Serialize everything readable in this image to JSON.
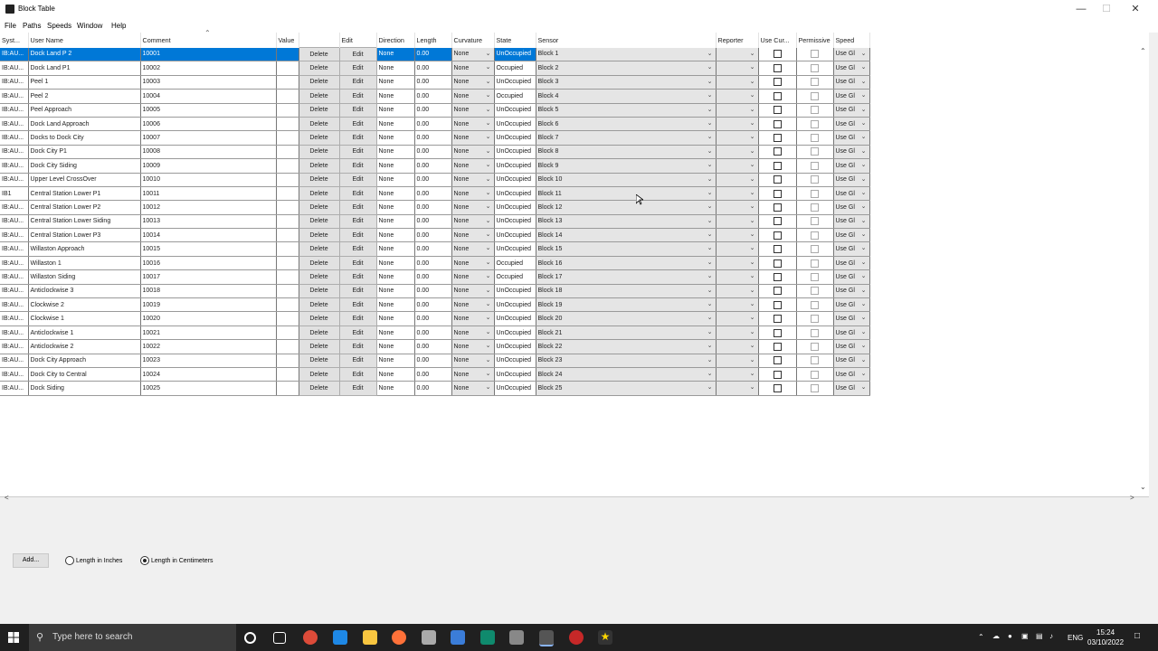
{
  "window": {
    "title": "Block Table"
  },
  "menu": [
    "File",
    "Paths",
    "Speeds",
    "Window",
    "Help"
  ],
  "columns": [
    "Syst...",
    "User Name",
    "Comment",
    "Value",
    "",
    "Edit",
    "Direction",
    "Length",
    "Curvature",
    "State",
    "Sensor",
    "Reporter",
    "Use Cur...",
    "Permissive",
    "Speed"
  ],
  "row_defaults": {
    "system_prefix": "IB:AU...",
    "delete_label": "Delete",
    "edit_label": "Edit",
    "direction": "None",
    "length": "0.00",
    "curvature": "None",
    "speed": "Use Gl"
  },
  "rows": [
    {
      "sys": "IB:AU...",
      "name": "Dock Land P 2",
      "comment": "10001",
      "state": "UnOccupied",
      "sensor": "Block 1",
      "selected": true
    },
    {
      "sys": "IB:AU...",
      "name": "Dock Land P1",
      "comment": "10002",
      "state": "Occupied",
      "sensor": "Block 2"
    },
    {
      "sys": "IB:AU...",
      "name": "Peel 1",
      "comment": "10003",
      "state": "UnOccupied",
      "sensor": "Block 3"
    },
    {
      "sys": "IB:AU...",
      "name": "Peel 2",
      "comment": "10004",
      "state": "Occupied",
      "sensor": "Block 4"
    },
    {
      "sys": "IB:AU...",
      "name": "Peel Approach",
      "comment": "10005",
      "state": "UnOccupied",
      "sensor": "Block 5"
    },
    {
      "sys": "IB:AU...",
      "name": "Dock Land Approach",
      "comment": "10006",
      "state": "UnOccupied",
      "sensor": "Block 6"
    },
    {
      "sys": "IB:AU...",
      "name": "Docks to Dock City",
      "comment": "10007",
      "state": "UnOccupied",
      "sensor": "Block 7"
    },
    {
      "sys": "IB:AU...",
      "name": "Dock City P1",
      "comment": "10008",
      "state": "UnOccupied",
      "sensor": "Block 8"
    },
    {
      "sys": "IB:AU...",
      "name": "Dock City Siding",
      "comment": "10009",
      "state": "UnOccupied",
      "sensor": "Block 9"
    },
    {
      "sys": "IB:AU...",
      "name": "Upper Level CrossOver",
      "comment": "10010",
      "state": "UnOccupied",
      "sensor": "Block 10"
    },
    {
      "sys": "IB1",
      "name": "Central Station Lower P1",
      "comment": "10011",
      "state": "UnOccupied",
      "sensor": "Block 11"
    },
    {
      "sys": "IB:AU...",
      "name": "Central Station Lower P2",
      "comment": "10012",
      "state": "UnOccupied",
      "sensor": "Block 12"
    },
    {
      "sys": "IB:AU...",
      "name": "Central Station Lower Siding",
      "comment": "10013",
      "state": "UnOccupied",
      "sensor": "Block 13"
    },
    {
      "sys": "IB:AU...",
      "name": "Central Station Lower P3",
      "comment": "10014",
      "state": "UnOccupied",
      "sensor": "Block 14"
    },
    {
      "sys": "IB:AU...",
      "name": "Willaston Approach",
      "comment": "10015",
      "state": "UnOccupied",
      "sensor": "Block 15"
    },
    {
      "sys": "IB:AU...",
      "name": "Willaston 1",
      "comment": "10016",
      "state": "Occupied",
      "sensor": "Block 16"
    },
    {
      "sys": "IB:AU...",
      "name": "Willaston Siding",
      "comment": "10017",
      "state": "Occupied",
      "sensor": "Block 17"
    },
    {
      "sys": "IB:AU...",
      "name": "Anticlockwise 3",
      "comment": "10018",
      "state": "UnOccupied",
      "sensor": "Block 18"
    },
    {
      "sys": "IB:AU...",
      "name": "Clockwise 2",
      "comment": "10019",
      "state": "UnOccupied",
      "sensor": "Block 19"
    },
    {
      "sys": "IB:AU...",
      "name": "Clockwise 1",
      "comment": "10020",
      "state": "UnOccupied",
      "sensor": "Block 20"
    },
    {
      "sys": "IB:AU...",
      "name": "Anticlockwise 1",
      "comment": "10021",
      "state": "UnOccupied",
      "sensor": "Block 21"
    },
    {
      "sys": "IB:AU...",
      "name": "Anticlockwise 2",
      "comment": "10022",
      "state": "UnOccupied",
      "sensor": "Block 22"
    },
    {
      "sys": "IB:AU...",
      "name": "Dock City Approach",
      "comment": "10023",
      "state": "UnOccupied",
      "sensor": "Block 23"
    },
    {
      "sys": "IB:AU...",
      "name": "Dock City to Central",
      "comment": "10024",
      "state": "UnOccupied",
      "sensor": "Block 24"
    },
    {
      "sys": "IB:AU...",
      "name": "Dock Siding",
      "comment": "10025",
      "state": "UnOccupied",
      "sensor": "Block 25"
    }
  ],
  "bottom": {
    "add_label": "Add...",
    "radio_inches": "Length in Inches",
    "radio_cm": "Length in Centimeters",
    "selected_unit": "cm"
  },
  "taskbar": {
    "search_placeholder": "Type here to search",
    "language": "ENG",
    "time": "15:24",
    "date": "03/10/2022"
  },
  "colors": {
    "selection": "#0078d7",
    "taskbar": "#202020"
  }
}
